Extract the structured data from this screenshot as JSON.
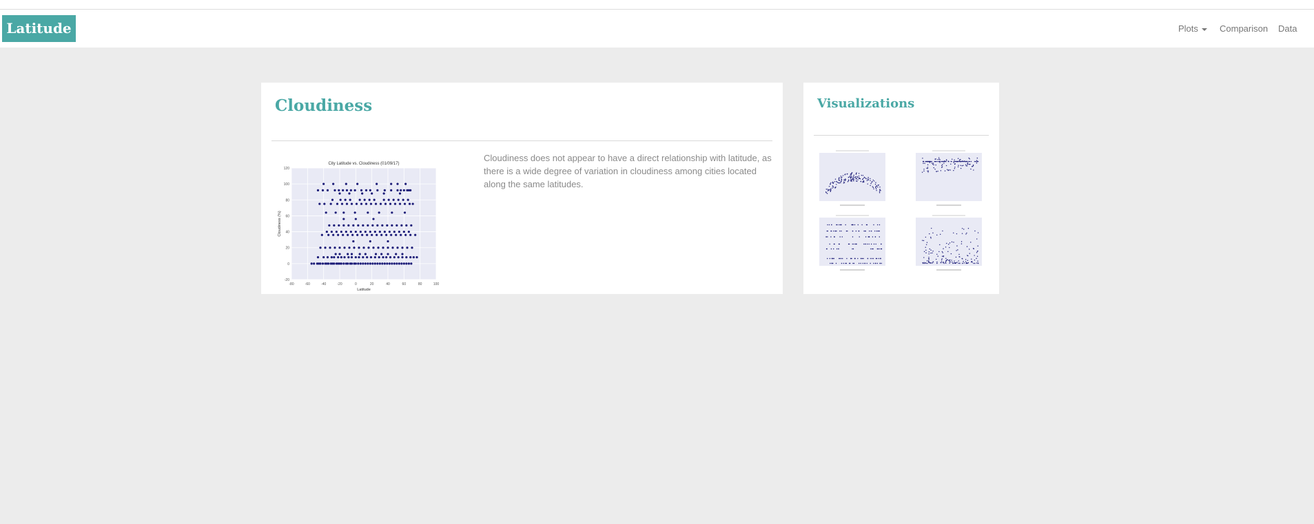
{
  "navbar": {
    "brand": "Latitude",
    "items": [
      {
        "label": "Plots"
      },
      {
        "label": "Comparison"
      },
      {
        "label": "Data"
      }
    ]
  },
  "main": {
    "title": "Cloudiness",
    "description": "Cloudiness does not appear to have a direct relationship with latitude, as there is a wide degree of variation in cloudiness among cities located along the same latitudes."
  },
  "sidebar": {
    "title": "Visualizations"
  },
  "colors": {
    "accent": "#4aa8a5",
    "background": "#ececec",
    "plot_face": "#e9eaf5",
    "marker": "#1c1c78"
  },
  "chart_data": {
    "type": "scatter",
    "title": "City Latitude vs. Cloudiness (01/09/17)",
    "xlabel": "Latitude",
    "ylabel": "Cloudiness (%)",
    "xlim": [
      -80,
      100
    ],
    "ylim": [
      -20,
      120
    ],
    "xticks": [
      -80,
      -60,
      -40,
      -20,
      0,
      20,
      40,
      60,
      80,
      100
    ],
    "yticks": [
      -20,
      0,
      20,
      40,
      60,
      80,
      100,
      120
    ],
    "grid": true,
    "x": [
      -55,
      -52,
      -48,
      -46,
      -44,
      -41,
      -38,
      -36,
      -34,
      -31,
      -29,
      -27,
      -24,
      -22,
      -20,
      -18,
      -15,
      -12,
      -10,
      -7,
      -5,
      -2,
      0,
      3,
      6,
      9,
      12,
      15,
      18,
      21,
      24,
      27,
      30,
      33,
      36,
      39,
      42,
      45,
      48,
      51,
      54,
      57,
      60,
      63,
      66,
      69,
      -47,
      -40,
      -35,
      -30,
      -27,
      -22,
      -18,
      -14,
      -9,
      -5,
      0,
      4,
      9,
      14,
      19,
      24,
      29,
      34,
      38,
      43,
      48,
      53,
      58,
      63,
      68,
      72,
      76,
      -25,
      -20,
      -10,
      -5,
      5,
      12,
      25,
      32,
      40,
      50,
      58,
      -44,
      -38,
      -32,
      -26,
      -20,
      -14,
      -8,
      -2,
      4,
      10,
      16,
      22,
      28,
      34,
      40,
      46,
      52,
      58,
      64,
      70,
      -42,
      -34,
      -28,
      -22,
      -16,
      -10,
      -4,
      2,
      8,
      14,
      20,
      26,
      32,
      38,
      44,
      50,
      56,
      62,
      68,
      74,
      -36,
      -30,
      -24,
      -18,
      -12,
      -6,
      0,
      6,
      12,
      18,
      24,
      30,
      36,
      42,
      48,
      54,
      60,
      66,
      -33,
      -27,
      -21,
      -15,
      -9,
      -3,
      3,
      9,
      15,
      21,
      27,
      33,
      39,
      45,
      51,
      57,
      63,
      69,
      -45,
      -39,
      -31,
      -23,
      -17,
      -11,
      -5,
      1,
      7,
      13,
      19,
      25,
      31,
      37,
      43,
      49,
      55,
      61,
      67,
      71,
      -29,
      -19,
      -13,
      -7,
      5,
      11,
      17,
      23,
      35,
      41,
      47,
      53,
      59,
      65,
      -37,
      -25,
      -15,
      -1,
      15,
      29,
      45,
      61,
      -47,
      -41,
      -35,
      -26,
      -21,
      -16,
      -11,
      -6,
      -1,
      7,
      13,
      18,
      27,
      36,
      44,
      52,
      56,
      60,
      64,
      66,
      68,
      -40,
      -28,
      -12,
      2,
      26,
      44,
      52,
      62,
      -20,
      -8,
      8,
      20,
      35,
      55,
      -15,
      0,
      22,
      -3,
      18,
      40
    ],
    "y": [
      0,
      0,
      0,
      0,
      0,
      0,
      0,
      0,
      0,
      0,
      0,
      0,
      0,
      0,
      0,
      0,
      0,
      0,
      0,
      0,
      0,
      0,
      0,
      0,
      0,
      0,
      0,
      0,
      0,
      0,
      0,
      0,
      0,
      0,
      0,
      0,
      0,
      0,
      0,
      0,
      0,
      0,
      0,
      0,
      0,
      0,
      8,
      8,
      8,
      8,
      8,
      8,
      8,
      8,
      8,
      8,
      8,
      8,
      8,
      8,
      8,
      8,
      8,
      8,
      8,
      8,
      8,
      8,
      8,
      8,
      8,
      8,
      8,
      12,
      12,
      12,
      12,
      12,
      12,
      12,
      12,
      12,
      12,
      12,
      20,
      20,
      20,
      20,
      20,
      20,
      20,
      20,
      20,
      20,
      20,
      20,
      20,
      20,
      20,
      20,
      20,
      20,
      20,
      20,
      36,
      36,
      36,
      36,
      36,
      36,
      36,
      36,
      36,
      36,
      36,
      36,
      36,
      36,
      36,
      36,
      36,
      36,
      36,
      36,
      40,
      40,
      40,
      40,
      40,
      40,
      40,
      40,
      40,
      40,
      40,
      40,
      40,
      40,
      40,
      40,
      40,
      40,
      48,
      48,
      48,
      48,
      48,
      48,
      48,
      48,
      48,
      48,
      48,
      48,
      48,
      48,
      48,
      48,
      48,
      48,
      75,
      75,
      75,
      75,
      75,
      75,
      75,
      75,
      75,
      75,
      75,
      75,
      75,
      75,
      75,
      75,
      75,
      75,
      75,
      75,
      80,
      80,
      80,
      80,
      80,
      80,
      80,
      80,
      80,
      80,
      80,
      80,
      80,
      80,
      64,
      64,
      64,
      64,
      64,
      64,
      64,
      64,
      92,
      92,
      92,
      92,
      92,
      92,
      92,
      92,
      92,
      92,
      92,
      92,
      92,
      92,
      92,
      92,
      92,
      92,
      92,
      92,
      92,
      100,
      100,
      100,
      100,
      100,
      100,
      100,
      100,
      88,
      88,
      88,
      88,
      88,
      88,
      56,
      56,
      56,
      28,
      28,
      28
    ]
  }
}
